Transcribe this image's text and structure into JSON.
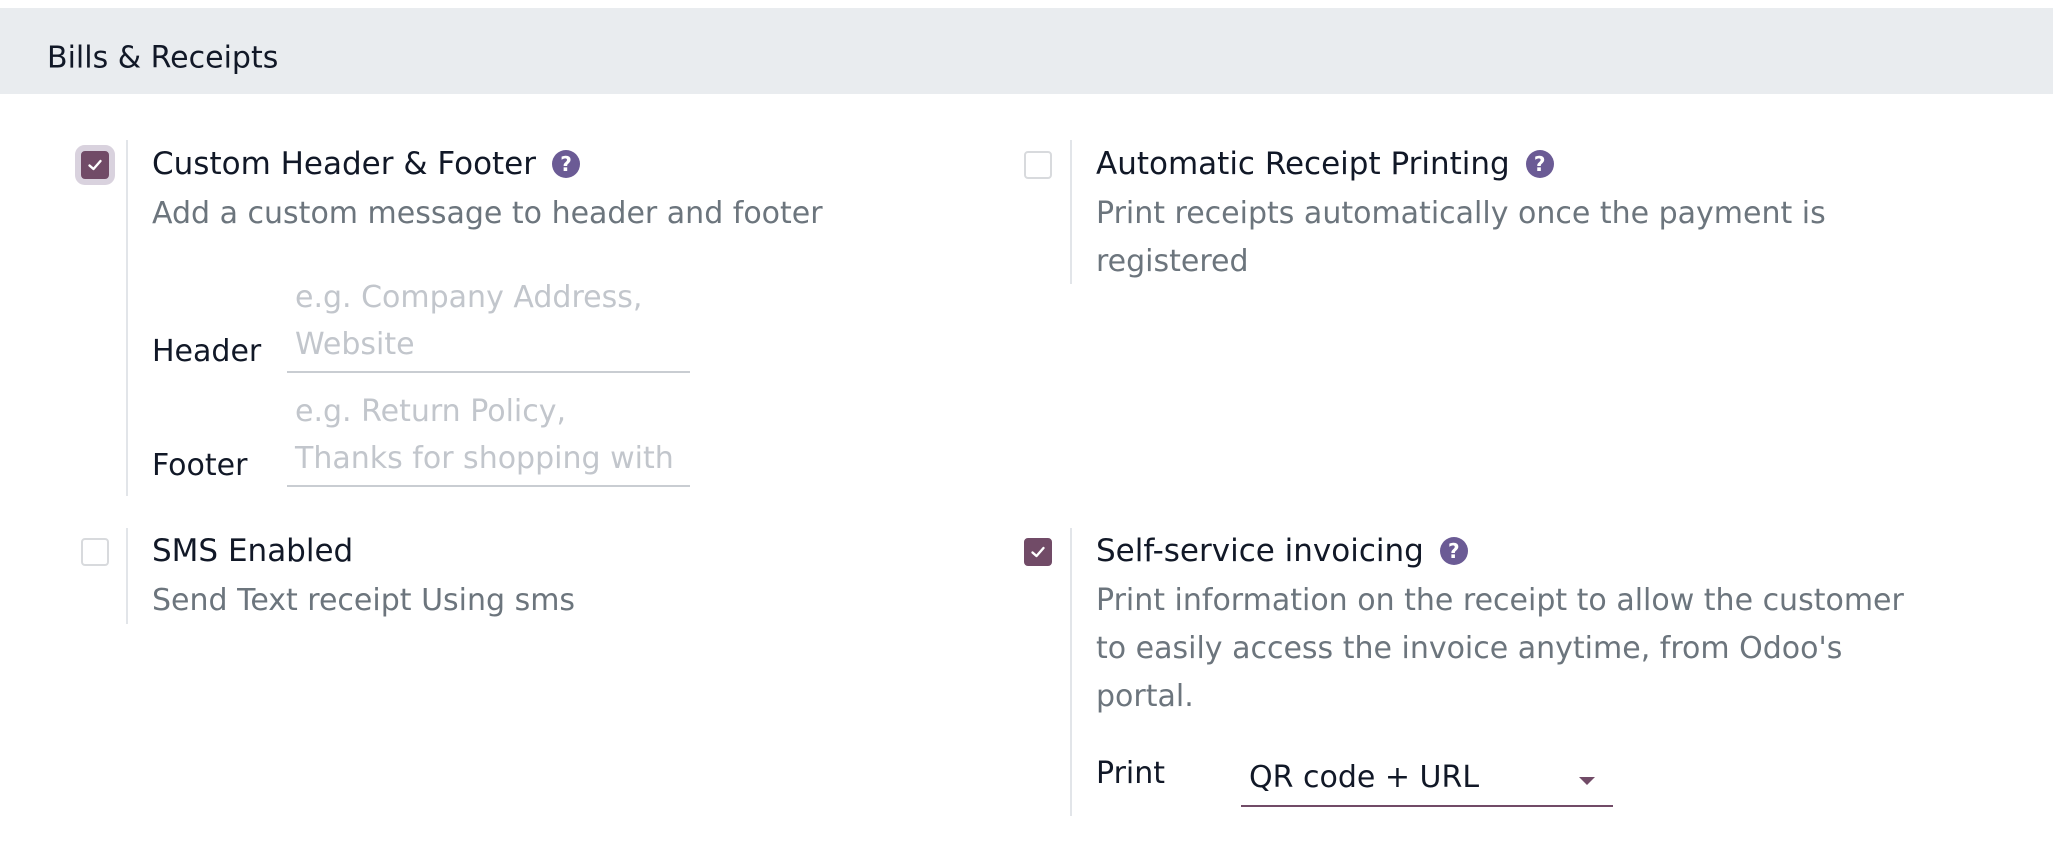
{
  "section": {
    "title": "Bills & Receipts"
  },
  "settings": {
    "custom_header_footer": {
      "title": "Custom Header & Footer",
      "description": "Add a custom message to header and footer",
      "checked": true,
      "header_label": "Header",
      "header_placeholder": "e.g. Company Address, Website",
      "footer_label": "Footer",
      "footer_placeholder": "e.g. Return Policy, Thanks for shopping with us!"
    },
    "automatic_receipt_printing": {
      "title": "Automatic Receipt Printing",
      "description": "Print receipts automatically once the payment is registered",
      "checked": false
    },
    "sms_enabled": {
      "title": "SMS Enabled",
      "description": "Send Text receipt Using sms",
      "checked": false
    },
    "self_service_invoicing": {
      "title": "Self-service invoicing",
      "description": "Print information on the receipt to allow the customer to easily access the invoice anytime, from Odoo's portal.",
      "checked": true,
      "print_label": "Print",
      "print_value": "QR code + URL"
    }
  },
  "icons": {
    "help": "question-circle-icon",
    "check": "checkmark-icon",
    "dropdown": "caret-down-icon"
  },
  "colors": {
    "accent": "#714b67",
    "help_icon": "#6b5b95",
    "section_bg": "#e9ecef",
    "muted_text": "#6c757d"
  }
}
